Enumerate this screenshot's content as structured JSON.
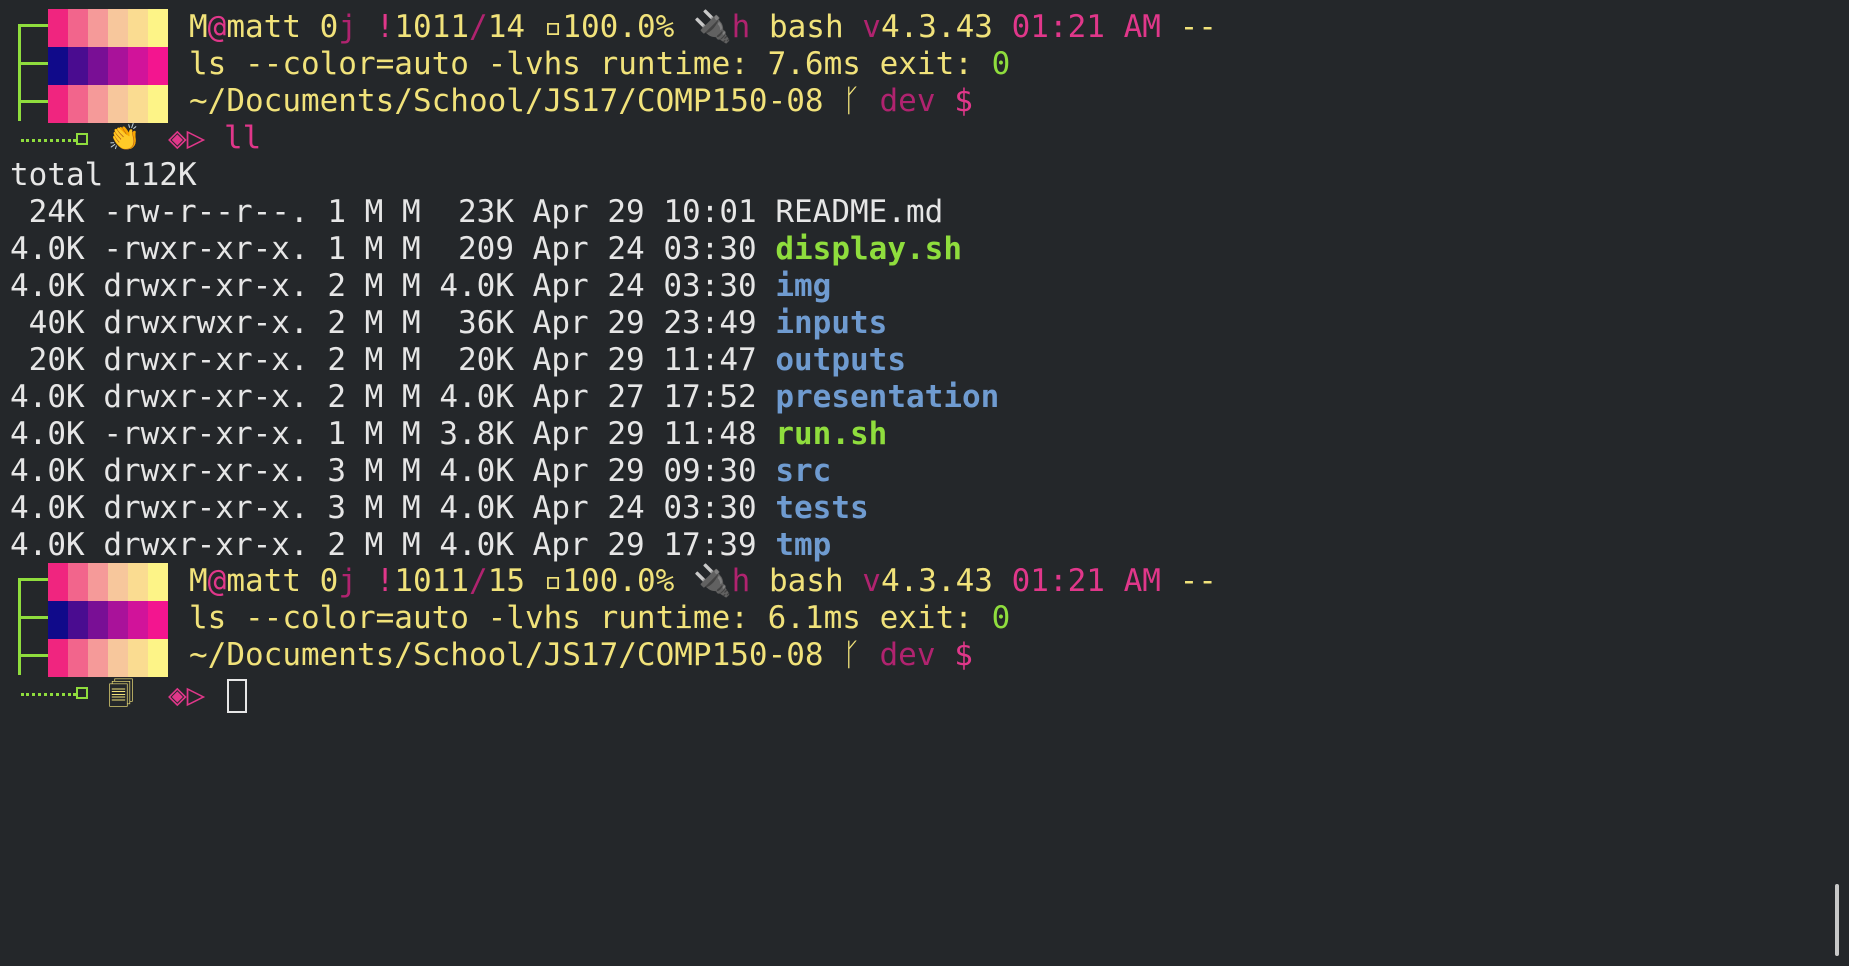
{
  "prompt1": {
    "user_m": "M",
    "at": "@",
    "user": "matt",
    "jobs_n": "0",
    "jobs_j": "j",
    "hist_bang": "!",
    "hist_n": "1011",
    "hist_slash": "/",
    "hist_count": "14",
    "batt_icon": "▫",
    "battery": "100.0%",
    "plug_icon": "🔌",
    "shell_h": "h",
    "shell": "bash",
    "ver_v": "v",
    "version": "4.3.43",
    "time": "01:21 AM",
    "dashes": "--",
    "last_cmd": "ls --color=auto -lvhs",
    "runtime_label": "runtime:",
    "runtime": "7.6ms",
    "exit_label": "exit:",
    "exit_code": "0",
    "cwd": "~/Documents/School/JS17/COMP150-08",
    "branch_icon": "ᚴ",
    "branch": "dev",
    "dollar": "$",
    "status_icon": "👏",
    "arrow": "◈▷",
    "command": "ll"
  },
  "listing": {
    "total": "total 112K",
    "rows": [
      {
        "size": " 24K",
        "perms": "-rw-r--r--.",
        "links": "1",
        "owner": "M",
        "group": "M",
        "bytes": " 23K",
        "month": "Apr",
        "day": "29",
        "time": "10:01",
        "name": "README.md",
        "kind": "file"
      },
      {
        "size": "4.0K",
        "perms": "-rwxr-xr-x.",
        "links": "1",
        "owner": "M",
        "group": "M",
        "bytes": " 209",
        "month": "Apr",
        "day": "24",
        "time": "03:30",
        "name": "display.sh",
        "kind": "exec"
      },
      {
        "size": "4.0K",
        "perms": "drwxr-xr-x.",
        "links": "2",
        "owner": "M",
        "group": "M",
        "bytes": "4.0K",
        "month": "Apr",
        "day": "24",
        "time": "03:30",
        "name": "img",
        "kind": "dir"
      },
      {
        "size": " 40K",
        "perms": "drwxrwxr-x.",
        "links": "2",
        "owner": "M",
        "group": "M",
        "bytes": " 36K",
        "month": "Apr",
        "day": "29",
        "time": "23:49",
        "name": "inputs",
        "kind": "dir"
      },
      {
        "size": " 20K",
        "perms": "drwxr-xr-x.",
        "links": "2",
        "owner": "M",
        "group": "M",
        "bytes": " 20K",
        "month": "Apr",
        "day": "29",
        "time": "11:47",
        "name": "outputs",
        "kind": "dir"
      },
      {
        "size": "4.0K",
        "perms": "drwxr-xr-x.",
        "links": "2",
        "owner": "M",
        "group": "M",
        "bytes": "4.0K",
        "month": "Apr",
        "day": "27",
        "time": "17:52",
        "name": "presentation",
        "kind": "dir"
      },
      {
        "size": "4.0K",
        "perms": "-rwxr-xr-x.",
        "links": "1",
        "owner": "M",
        "group": "M",
        "bytes": "3.8K",
        "month": "Apr",
        "day": "29",
        "time": "11:48",
        "name": "run.sh",
        "kind": "exec"
      },
      {
        "size": "4.0K",
        "perms": "drwxr-xr-x.",
        "links": "3",
        "owner": "M",
        "group": "M",
        "bytes": "4.0K",
        "month": "Apr",
        "day": "29",
        "time": "09:30",
        "name": "src",
        "kind": "dir"
      },
      {
        "size": "4.0K",
        "perms": "drwxr-xr-x.",
        "links": "3",
        "owner": "M",
        "group": "M",
        "bytes": "4.0K",
        "month": "Apr",
        "day": "24",
        "time": "03:30",
        "name": "tests",
        "kind": "dir"
      },
      {
        "size": "4.0K",
        "perms": "drwxr-xr-x.",
        "links": "2",
        "owner": "M",
        "group": "M",
        "bytes": "4.0K",
        "month": "Apr",
        "day": "29",
        "time": "17:39",
        "name": "tmp",
        "kind": "dir"
      }
    ]
  },
  "prompt2": {
    "hist_count": "15",
    "runtime": "6.1ms",
    "status_icon": "🗐",
    "command": ""
  },
  "colors": {
    "background": "#24272a",
    "yellow": "#f1e27a",
    "pink": "#e0378a",
    "green": "#8fdd3d",
    "blue": "#6f9bd0",
    "block_row1": [
      "#f0257f",
      "#f2658c",
      "#f59a99",
      "#f7c79c",
      "#fadc91",
      "#fdf487"
    ],
    "block_row2": [
      "#100a8a",
      "#4a0c90",
      "#790f95",
      "#a9129a",
      "#d1139a",
      "#f3158f"
    ],
    "block_row3": [
      "#f0257f",
      "#f2658c",
      "#f59a99",
      "#f7c79c",
      "#fadc91",
      "#fdf487"
    ]
  },
  "icons": {
    "tree": "tree-connector-icon",
    "battery": "battery-icon",
    "plug": "plug-icon",
    "branch": "git-branch-icon",
    "clap": "clap-icon",
    "copy": "copy-icon",
    "arrow": "prompt-arrow-icon"
  }
}
